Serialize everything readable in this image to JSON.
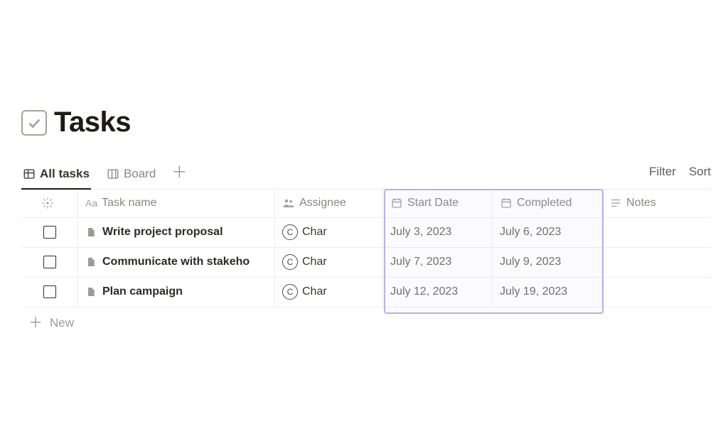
{
  "page_title": "Tasks",
  "tabs": {
    "all_tasks": "All tasks",
    "board": "Board"
  },
  "controls": {
    "filter": "Filter",
    "sort": "Sort"
  },
  "columns": {
    "task_name": "Task name",
    "assignee": "Assignee",
    "start_date": "Start Date",
    "completed": "Completed",
    "notes": "Notes"
  },
  "assignee_short": "Char",
  "assignee_initial": "C",
  "rows": [
    {
      "title": "Write project proposal",
      "assignee": "Char",
      "start": "July 3, 2023",
      "completed": "July 6, 2023"
    },
    {
      "title": "Communicate with stakeho",
      "assignee": "Char",
      "start": "July 7, 2023",
      "completed": "July 9, 2023"
    },
    {
      "title": "Plan campaign",
      "assignee": "Char",
      "start": "July 12, 2023",
      "completed": "July 19, 2023"
    }
  ],
  "new_row_label": "New"
}
